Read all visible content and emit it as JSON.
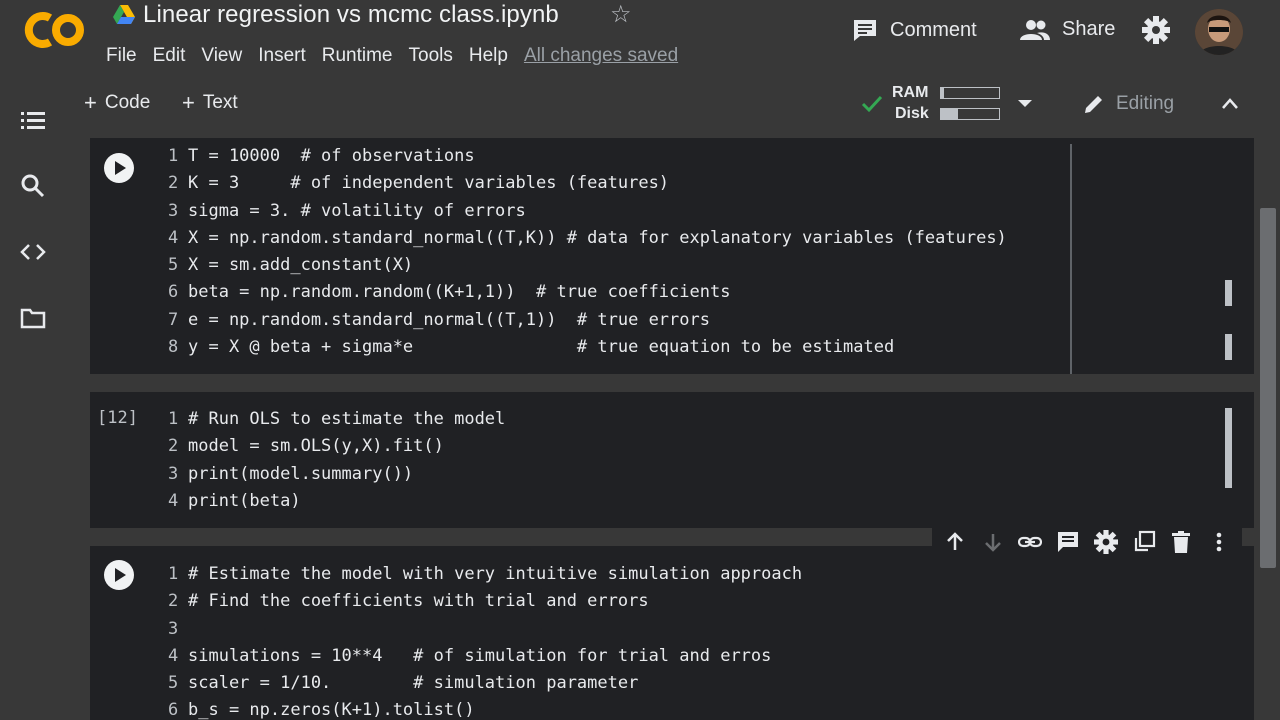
{
  "header": {
    "doc_title": "Linear regression vs mcmc class.ipynb",
    "menu": [
      "File",
      "Edit",
      "View",
      "Insert",
      "Runtime",
      "Tools",
      "Help"
    ],
    "saved_status": "All changes saved",
    "comment_label": "Comment",
    "share_label": "Share",
    "icons": {
      "logo": "colab-logo",
      "drive": "google-drive-icon",
      "star": "star-icon",
      "comment": "comment-icon",
      "share": "people-icon",
      "settings": "gear-icon"
    }
  },
  "toolbar": {
    "add_code_label": "Code",
    "add_text_label": "Text",
    "ram_label": "RAM",
    "disk_label": "Disk",
    "ram_usage": 0.05,
    "disk_usage": 0.3,
    "editing_label": "Editing"
  },
  "colors": {
    "background": "#383838",
    "cell_bg": "#202124",
    "text": "#e8eaed",
    "check_green": "#34a853"
  },
  "cells": [
    {
      "execution_count": "",
      "lines": [
        "T = 10000  # of observations",
        "K = 3     # of independent variables (features)",
        "sigma = 3. # volatility of errors",
        "X = np.random.standard_normal((T,K)) # data for explanatory variables (features)",
        "X = sm.add_constant(X)",
        "beta = np.random.random((K+1,1))  # true coefficients",
        "e = np.random.standard_normal((T,1))  # true errors",
        "y = X @ beta + sigma*e                # true equation to be estimated"
      ]
    },
    {
      "execution_count": "[12]",
      "lines": [
        "# Run OLS to estimate the model",
        "model = sm.OLS(y,X).fit()",
        "print(model.summary())",
        "print(beta)"
      ]
    },
    {
      "execution_count": "",
      "lines": [
        "# Estimate the model with very intuitive simulation approach",
        "# Find the coefficients with trial and errors",
        "",
        "simulations = 10**4   # of simulation for trial and erros",
        "scaler = 1/10.        # simulation parameter",
        "b_s = np.zeros(K+1).tolist()"
      ]
    }
  ]
}
